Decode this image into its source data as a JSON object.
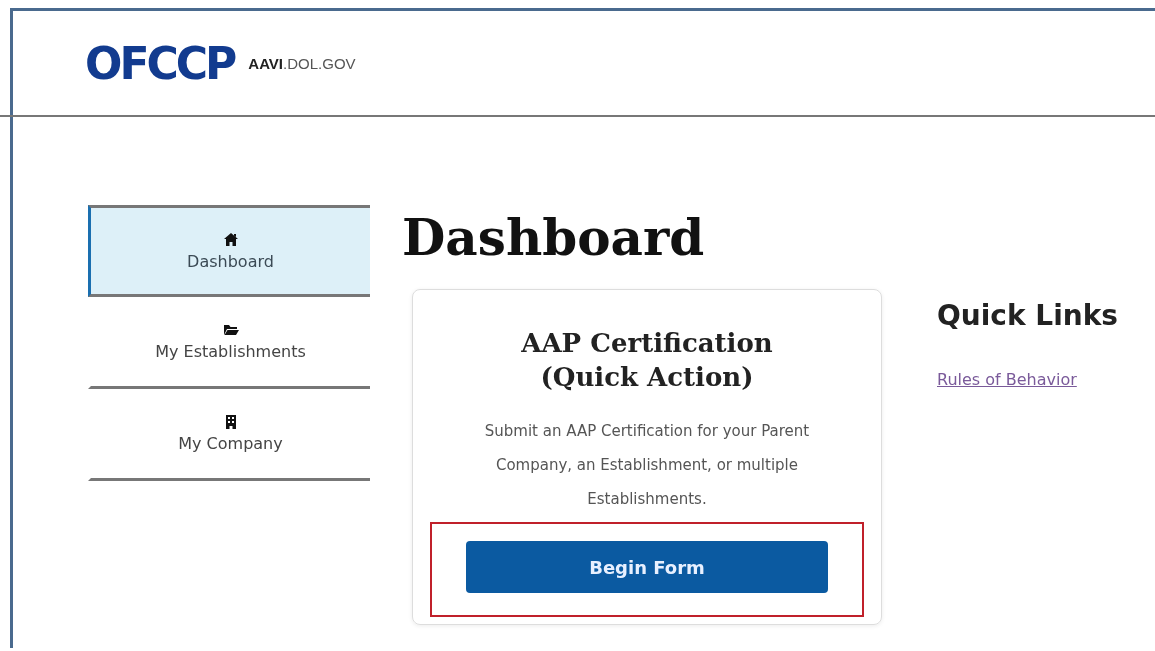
{
  "header": {
    "logo": "OFCCP",
    "site": "**AAVI**.DOL.GOV"
  },
  "sidebar": {
    "items": [
      {
        "label": "Dashboard",
        "selected": true
      },
      {
        "label": "My Establishments",
        "selected": false
      },
      {
        "label": "My Company",
        "selected": false
      }
    ]
  },
  "page_title": "Dashboard",
  "card": {
    "title": "AAP Certification (Quick Action)",
    "description": "Submit an AAP Certification for your Parent Company, an Establishment, or multiple Establishments.",
    "button": "Begin Form",
    "button_highlighted": true
  },
  "quick_links": {
    "title": "Quick Links",
    "links": [
      "Rules of Behavior"
    ]
  }
}
